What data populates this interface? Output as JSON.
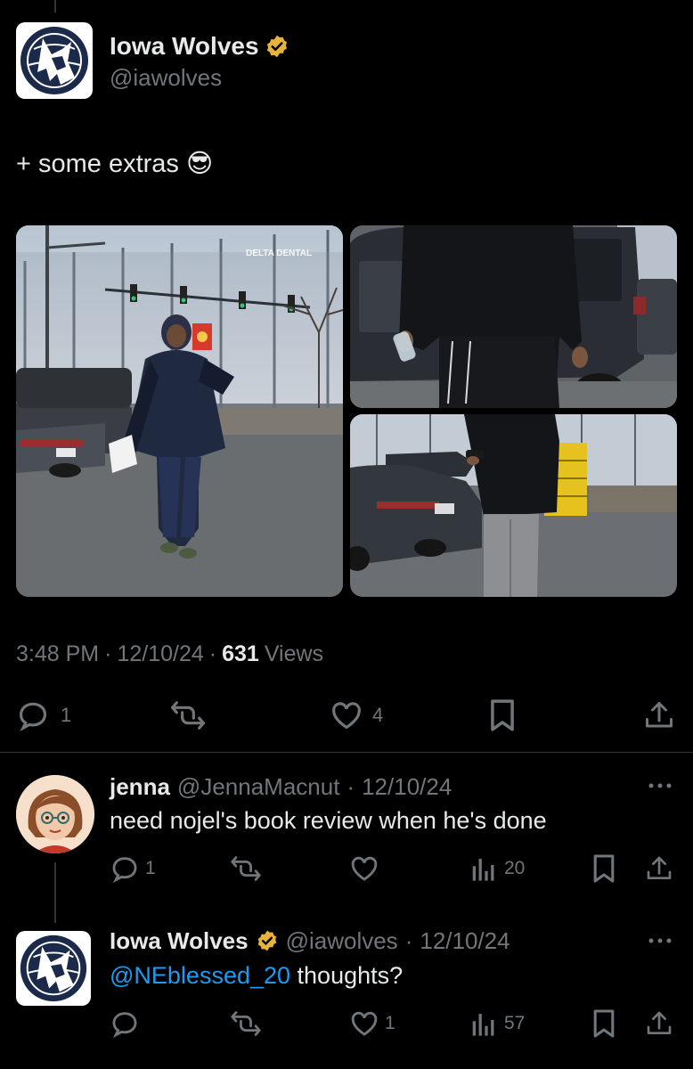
{
  "main_post": {
    "author_name": "Iowa Wolves",
    "author_handle": "@iawolves",
    "text": "+ some extras 😎",
    "time": "3:48 PM",
    "date": "12/10/24",
    "views_count": "631",
    "views_label": "Views",
    "replies": "1",
    "likes": "4",
    "watermark": "DELTA DENTAL"
  },
  "reply1": {
    "author_name": "jenna",
    "author_handle": "@JennaMacnut",
    "date": "12/10/24",
    "text": "need nojel's book review when he's done",
    "replies": "1",
    "views": "20"
  },
  "reply2": {
    "author_name": "Iowa Wolves",
    "author_handle": "@iawolves",
    "date": "12/10/24",
    "mention": "@NEblessed_20",
    "text": " thoughts?",
    "likes": "1",
    "views": "57"
  },
  "separator": "·",
  "colors": {
    "accent": "#1d9bf0",
    "verified": "#e8b33b",
    "muted": "#71767b",
    "brand_navy": "#1b2a4a"
  },
  "icons": [
    "reply-icon",
    "repost-icon",
    "like-icon",
    "bookmark-icon",
    "share-icon",
    "views-icon",
    "more-icon",
    "verified-badge-icon"
  ]
}
